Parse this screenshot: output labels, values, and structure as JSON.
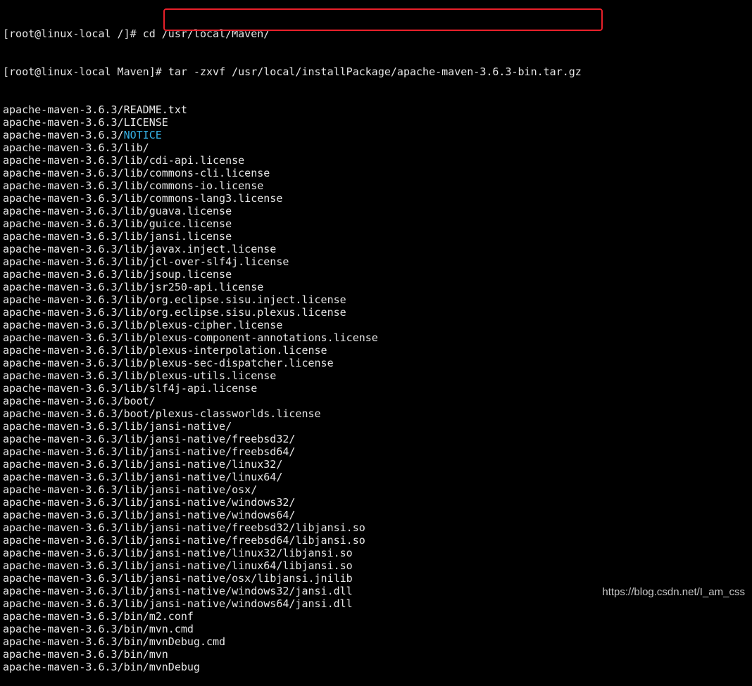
{
  "terminal": {
    "line1": {
      "prompt": "[root@linux-local /]# ",
      "command": "cd /usr/local/Maven/"
    },
    "line2": {
      "prompt": "[root@linux-local Maven]# ",
      "command": "tar -zxvf /usr/local/installPackage/apache-maven-3.6.3-bin.tar.gz"
    },
    "output": [
      "apache-maven-3.6.3/README.txt",
      "apache-maven-3.6.3/LICENSE",
      {
        "prefix": "apache-maven-3.6.3/",
        "highlight": "NOTICE"
      },
      "apache-maven-3.6.3/lib/",
      "apache-maven-3.6.3/lib/cdi-api.license",
      "apache-maven-3.6.3/lib/commons-cli.license",
      "apache-maven-3.6.3/lib/commons-io.license",
      "apache-maven-3.6.3/lib/commons-lang3.license",
      "apache-maven-3.6.3/lib/guava.license",
      "apache-maven-3.6.3/lib/guice.license",
      "apache-maven-3.6.3/lib/jansi.license",
      "apache-maven-3.6.3/lib/javax.inject.license",
      "apache-maven-3.6.3/lib/jcl-over-slf4j.license",
      "apache-maven-3.6.3/lib/jsoup.license",
      "apache-maven-3.6.3/lib/jsr250-api.license",
      "apache-maven-3.6.3/lib/org.eclipse.sisu.inject.license",
      "apache-maven-3.6.3/lib/org.eclipse.sisu.plexus.license",
      "apache-maven-3.6.3/lib/plexus-cipher.license",
      "apache-maven-3.6.3/lib/plexus-component-annotations.license",
      "apache-maven-3.6.3/lib/plexus-interpolation.license",
      "apache-maven-3.6.3/lib/plexus-sec-dispatcher.license",
      "apache-maven-3.6.3/lib/plexus-utils.license",
      "apache-maven-3.6.3/lib/slf4j-api.license",
      "apache-maven-3.6.3/boot/",
      "apache-maven-3.6.3/boot/plexus-classworlds.license",
      "apache-maven-3.6.3/lib/jansi-native/",
      "apache-maven-3.6.3/lib/jansi-native/freebsd32/",
      "apache-maven-3.6.3/lib/jansi-native/freebsd64/",
      "apache-maven-3.6.3/lib/jansi-native/linux32/",
      "apache-maven-3.6.3/lib/jansi-native/linux64/",
      "apache-maven-3.6.3/lib/jansi-native/osx/",
      "apache-maven-3.6.3/lib/jansi-native/windows32/",
      "apache-maven-3.6.3/lib/jansi-native/windows64/",
      "apache-maven-3.6.3/lib/jansi-native/freebsd32/libjansi.so",
      "apache-maven-3.6.3/lib/jansi-native/freebsd64/libjansi.so",
      "apache-maven-3.6.3/lib/jansi-native/linux32/libjansi.so",
      "apache-maven-3.6.3/lib/jansi-native/linux64/libjansi.so",
      "apache-maven-3.6.3/lib/jansi-native/osx/libjansi.jnilib",
      "apache-maven-3.6.3/lib/jansi-native/windows32/jansi.dll",
      "apache-maven-3.6.3/lib/jansi-native/windows64/jansi.dll",
      "apache-maven-3.6.3/bin/m2.conf",
      "apache-maven-3.6.3/bin/mvn.cmd",
      "apache-maven-3.6.3/bin/mvnDebug.cmd",
      "apache-maven-3.6.3/bin/mvn",
      "apache-maven-3.6.3/bin/mvnDebug"
    ]
  },
  "watermark": "https://blog.csdn.net/I_am_css",
  "colors": {
    "background": "#000000",
    "text": "#e6e6e6",
    "highlight_box": "#e8202a",
    "notice_accent": "#36b3e8"
  }
}
